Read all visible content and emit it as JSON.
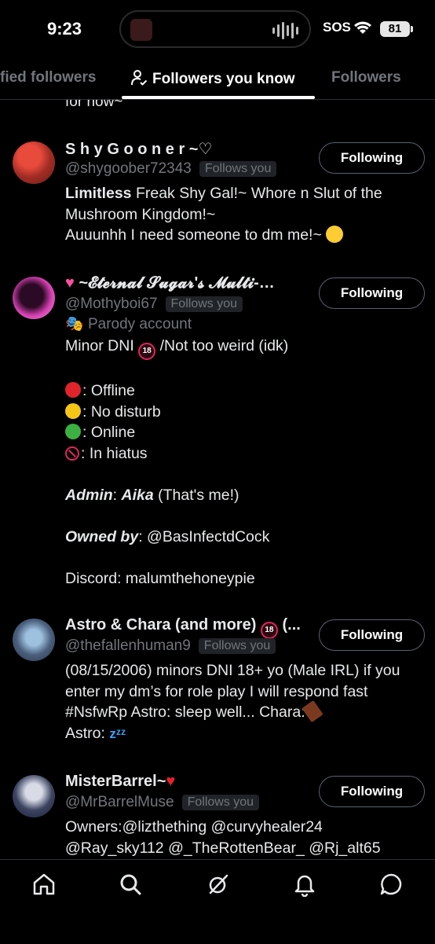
{
  "status_bar": {
    "time": "9:23",
    "sos": "SOS",
    "battery": "81"
  },
  "tabs": [
    {
      "label": "fied followers",
      "active": false
    },
    {
      "label": "Followers you know",
      "active": true
    },
    {
      "label": "Followers",
      "active": false
    }
  ],
  "feed": {
    "cutoff_text": "for now~",
    "users": [
      {
        "name": "S h y  G o o n e r ~♡",
        "handle": "@shygoober72343",
        "follows_you": "Follows you",
        "button": "Following",
        "bio": {
          "line1_bold": "Limitless",
          "line1_rest": " Freak Shy Gal!~ Whore n Slut of the",
          "line2": "Mushroom Kingdom!~",
          "line3": "Auuunhh I need someone to dm me!~"
        }
      },
      {
        "name": "~𝓔𝓽𝓮𝓻𝓷𝓪𝓵 𝓢𝓾𝓰𝓪𝓻'𝓼 𝓜𝓾𝓵𝓽𝓲-…",
        "handle": "@Mothyboi67",
        "follows_you": "Follows you",
        "button": "Following",
        "parody": "Parody account",
        "bio": {
          "line1_a": "Minor DNI ",
          "badge": "18",
          "line1_b": " /Not too weird (idk)",
          "status_offline": ": Offline",
          "status_disturb": ": No disturb",
          "status_online": ": Online",
          "status_hiatus": ": In hiatus",
          "admin_label": "Admin",
          "admin_name": "Aika",
          "admin_rest": " (That's me!)",
          "owned_label": "Owned by",
          "owned_rest": ": @BasInfectdCock",
          "discord": "Discord: malumthehoneypie"
        }
      },
      {
        "name": "Astro & Chara (and more)",
        "name_suffix": " (...",
        "handle": "@thefallenhuman9",
        "follows_you": "Follows you",
        "button": "Following",
        "bio": {
          "line1": "(08/15/2006) minors DNI 18+ yo (Male IRL) if you",
          "line2": "enter my dm’s for role play I will respond fast",
          "line3": "#NsfwRp Astro: sleep well... Chara:",
          "line4": "Astro: ",
          "zzz": "zᶻᶻ"
        }
      },
      {
        "name": "MisterBarrel~",
        "handle": "@MrBarrelMuse",
        "follows_you": "Follows you",
        "button": "Following",
        "bio": {
          "line1": "Owners:@lizthething @curvyhealer24",
          "line2": "@Ray_sky112 @_TheRottenBear_ @Rj_alt65"
        }
      }
    ]
  },
  "nav": [
    "home-icon",
    "search-icon",
    "grok-icon",
    "notifications-icon",
    "messages-icon"
  ],
  "colors": {
    "background": "#000000",
    "text": "#e7e9ea",
    "muted": "#71767b",
    "border": "#2f3336"
  }
}
